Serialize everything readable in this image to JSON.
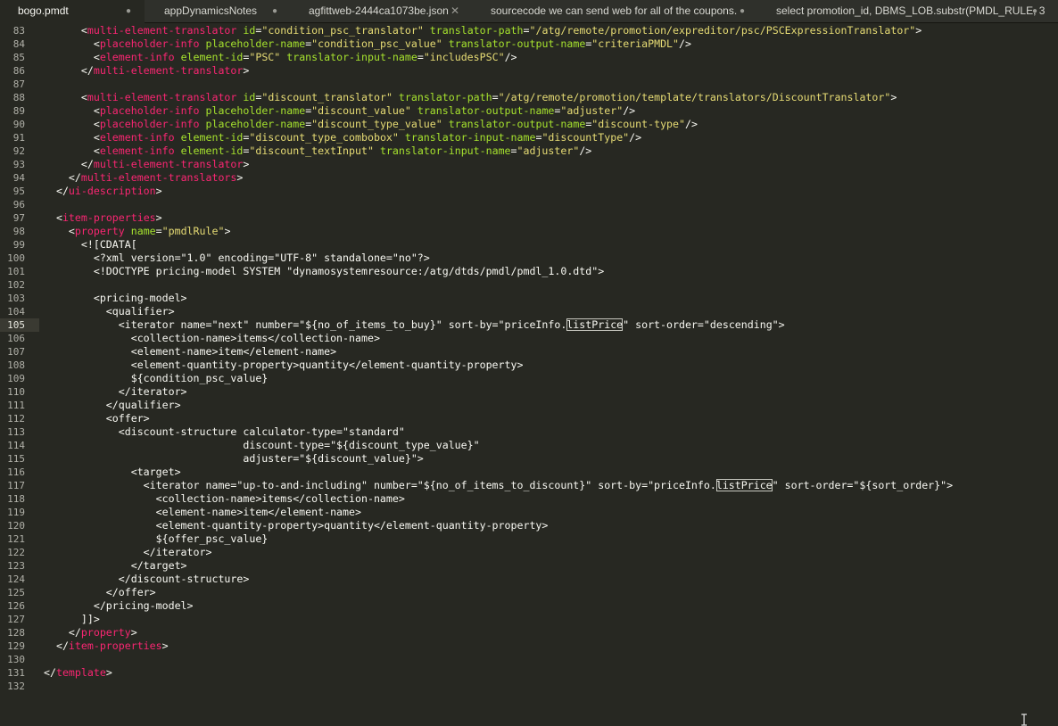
{
  "tabs": [
    {
      "label": "bogo.pmdt",
      "close": "●",
      "active": true
    },
    {
      "label": "appDynamicsNotes",
      "close": "●",
      "active": false
    },
    {
      "label": "agfittweb-2444ca1073be.json",
      "close": "✕",
      "active": false
    },
    {
      "label": "sourcecode we can send web for all of the coupons.",
      "close": "●",
      "active": false
    },
    {
      "label": "select promotion_id,  DBMS_LOB.substr(PMDL_RULE, 3",
      "close": "●",
      "active": false
    }
  ],
  "current_line": 105,
  "lines": [
    {
      "n": "83",
      "s": [
        [
          "pl",
          "      <"
        ],
        [
          "tg",
          "multi-element-translator"
        ],
        [
          "at",
          " id"
        ],
        [
          "pl",
          "="
        ],
        [
          "st",
          "\"condition_psc_translator\""
        ],
        [
          "at",
          " translator-path"
        ],
        [
          "pl",
          "="
        ],
        [
          "st",
          "\"/atg/remote/promotion/expreditor/psc/PSCExpressionTranslator\""
        ],
        [
          "pl",
          ">"
        ]
      ]
    },
    {
      "n": "84",
      "s": [
        [
          "pl",
          "        <"
        ],
        [
          "tg",
          "placeholder-info"
        ],
        [
          "at",
          " placeholder-name"
        ],
        [
          "pl",
          "="
        ],
        [
          "st",
          "\"condition_psc_value\""
        ],
        [
          "at",
          " translator-output-name"
        ],
        [
          "pl",
          "="
        ],
        [
          "st",
          "\"criteriaPMDL\""
        ],
        [
          "pl",
          "/>"
        ]
      ]
    },
    {
      "n": "85",
      "s": [
        [
          "pl",
          "        <"
        ],
        [
          "tg",
          "element-info"
        ],
        [
          "at",
          " element-id"
        ],
        [
          "pl",
          "="
        ],
        [
          "st",
          "\"PSC\""
        ],
        [
          "at",
          " translator-input-name"
        ],
        [
          "pl",
          "="
        ],
        [
          "st",
          "\"includesPSC\""
        ],
        [
          "pl",
          "/>"
        ]
      ]
    },
    {
      "n": "86",
      "s": [
        [
          "pl",
          "      </"
        ],
        [
          "tg",
          "multi-element-translator"
        ],
        [
          "pl",
          ">"
        ]
      ]
    },
    {
      "n": "87",
      "s": []
    },
    {
      "n": "88",
      "s": [
        [
          "pl",
          "      <"
        ],
        [
          "tg",
          "multi-element-translator"
        ],
        [
          "at",
          " id"
        ],
        [
          "pl",
          "="
        ],
        [
          "st",
          "\"discount_translator\""
        ],
        [
          "at",
          " translator-path"
        ],
        [
          "pl",
          "="
        ],
        [
          "st",
          "\"/atg/remote/promotion/template/translators/DiscountTranslator\""
        ],
        [
          "pl",
          ">"
        ]
      ]
    },
    {
      "n": "89",
      "s": [
        [
          "pl",
          "        <"
        ],
        [
          "tg",
          "placeholder-info"
        ],
        [
          "at",
          " placeholder-name"
        ],
        [
          "pl",
          "="
        ],
        [
          "st",
          "\"discount_value\""
        ],
        [
          "at",
          " translator-output-name"
        ],
        [
          "pl",
          "="
        ],
        [
          "st",
          "\"adjuster\""
        ],
        [
          "pl",
          "/>"
        ]
      ]
    },
    {
      "n": "90",
      "s": [
        [
          "pl",
          "        <"
        ],
        [
          "tg",
          "placeholder-info"
        ],
        [
          "at",
          " placeholder-name"
        ],
        [
          "pl",
          "="
        ],
        [
          "st",
          "\"discount_type_value\""
        ],
        [
          "at",
          " translator-output-name"
        ],
        [
          "pl",
          "="
        ],
        [
          "st",
          "\"discount-type\""
        ],
        [
          "pl",
          "/>"
        ]
      ]
    },
    {
      "n": "91",
      "s": [
        [
          "pl",
          "        <"
        ],
        [
          "tg",
          "element-info"
        ],
        [
          "at",
          " element-id"
        ],
        [
          "pl",
          "="
        ],
        [
          "st",
          "\"discount_type_combobox\""
        ],
        [
          "at",
          " translator-input-name"
        ],
        [
          "pl",
          "="
        ],
        [
          "st",
          "\"discountType\""
        ],
        [
          "pl",
          "/>"
        ]
      ]
    },
    {
      "n": "92",
      "s": [
        [
          "pl",
          "        <"
        ],
        [
          "tg",
          "element-info"
        ],
        [
          "at",
          " element-id"
        ],
        [
          "pl",
          "="
        ],
        [
          "st",
          "\"discount_textInput\""
        ],
        [
          "at",
          " translator-input-name"
        ],
        [
          "pl",
          "="
        ],
        [
          "st",
          "\"adjuster\""
        ],
        [
          "pl",
          "/>"
        ]
      ]
    },
    {
      "n": "93",
      "s": [
        [
          "pl",
          "      </"
        ],
        [
          "tg",
          "multi-element-translator"
        ],
        [
          "pl",
          ">"
        ]
      ]
    },
    {
      "n": "94",
      "s": [
        [
          "pl",
          "    </"
        ],
        [
          "tg",
          "multi-element-translators"
        ],
        [
          "pl",
          ">"
        ]
      ]
    },
    {
      "n": "95",
      "s": [
        [
          "pl",
          "  </"
        ],
        [
          "tg",
          "ui-description"
        ],
        [
          "pl",
          ">"
        ]
      ]
    },
    {
      "n": "96",
      "s": []
    },
    {
      "n": "97",
      "s": [
        [
          "pl",
          "  <"
        ],
        [
          "tg",
          "item-properties"
        ],
        [
          "pl",
          ">"
        ]
      ]
    },
    {
      "n": "98",
      "s": [
        [
          "pl",
          "    <"
        ],
        [
          "tg",
          "property"
        ],
        [
          "at",
          " name"
        ],
        [
          "pl",
          "="
        ],
        [
          "st",
          "\"pmdlRule\""
        ],
        [
          "pl",
          ">"
        ]
      ]
    },
    {
      "n": "99",
      "s": [
        [
          "pl",
          "      <![CDATA["
        ]
      ]
    },
    {
      "n": "100",
      "s": [
        [
          "pl",
          "        <?xml version=\"1.0\" encoding=\"UTF-8\" standalone=\"no\"?>"
        ]
      ]
    },
    {
      "n": "101",
      "s": [
        [
          "pl",
          "        <!DOCTYPE pricing-model SYSTEM \"dynamosystemresource:/atg/dtds/pmdl/pmdl_1.0.dtd\">"
        ]
      ]
    },
    {
      "n": "102",
      "s": []
    },
    {
      "n": "103",
      "s": [
        [
          "pl",
          "        <pricing-model>"
        ]
      ]
    },
    {
      "n": "104",
      "s": [
        [
          "pl",
          "          <qualifier>"
        ]
      ]
    },
    {
      "n": "105",
      "s": [
        [
          "pl",
          "            <iterator name=\"next\" number=\"${no_of_items_to_buy}\" sort-by=\"priceInfo."
        ],
        [
          "hl",
          "listPrice"
        ],
        [
          "pl",
          "\" sort-order=\"descending\">"
        ]
      ]
    },
    {
      "n": "106",
      "s": [
        [
          "pl",
          "              <collection-name>items</collection-name>"
        ]
      ]
    },
    {
      "n": "107",
      "s": [
        [
          "pl",
          "              <element-name>item</element-name>"
        ]
      ]
    },
    {
      "n": "108",
      "s": [
        [
          "pl",
          "              <element-quantity-property>quantity</element-quantity-property>"
        ]
      ]
    },
    {
      "n": "109",
      "s": [
        [
          "pl",
          "              ${condition_psc_value}"
        ]
      ]
    },
    {
      "n": "110",
      "s": [
        [
          "pl",
          "            </iterator>"
        ]
      ]
    },
    {
      "n": "111",
      "s": [
        [
          "pl",
          "          </qualifier>"
        ]
      ]
    },
    {
      "n": "112",
      "s": [
        [
          "pl",
          "          <offer>"
        ]
      ]
    },
    {
      "n": "113",
      "s": [
        [
          "pl",
          "            <discount-structure calculator-type=\"standard\""
        ]
      ]
    },
    {
      "n": "114",
      "s": [
        [
          "pl",
          "                                discount-type=\"${discount_type_value}\""
        ]
      ]
    },
    {
      "n": "115",
      "s": [
        [
          "pl",
          "                                adjuster=\"${discount_value}\">"
        ]
      ]
    },
    {
      "n": "116",
      "s": [
        [
          "pl",
          "              <target>"
        ]
      ]
    },
    {
      "n": "117",
      "s": [
        [
          "pl",
          "                <iterator name=\"up-to-and-including\" number=\"${no_of_items_to_discount}\" sort-by=\"priceInfo."
        ],
        [
          "hl",
          "listPrice"
        ],
        [
          "pl",
          "\" sort-order=\"${sort_order}\">"
        ]
      ]
    },
    {
      "n": "118",
      "s": [
        [
          "pl",
          "                  <collection-name>items</collection-name>"
        ]
      ]
    },
    {
      "n": "119",
      "s": [
        [
          "pl",
          "                  <element-name>item</element-name>"
        ]
      ]
    },
    {
      "n": "120",
      "s": [
        [
          "pl",
          "                  <element-quantity-property>quantity</element-quantity-property>"
        ]
      ]
    },
    {
      "n": "121",
      "s": [
        [
          "pl",
          "                  ${offer_psc_value}"
        ]
      ]
    },
    {
      "n": "122",
      "s": [
        [
          "pl",
          "                </iterator>"
        ]
      ]
    },
    {
      "n": "123",
      "s": [
        [
          "pl",
          "              </target>"
        ]
      ]
    },
    {
      "n": "124",
      "s": [
        [
          "pl",
          "            </discount-structure>"
        ]
      ]
    },
    {
      "n": "125",
      "s": [
        [
          "pl",
          "          </offer>"
        ]
      ]
    },
    {
      "n": "126",
      "s": [
        [
          "pl",
          "        </pricing-model>"
        ]
      ]
    },
    {
      "n": "127",
      "s": [
        [
          "pl",
          "      ]]>"
        ]
      ]
    },
    {
      "n": "128",
      "s": [
        [
          "pl",
          "    </"
        ],
        [
          "tg",
          "property"
        ],
        [
          "pl",
          ">"
        ]
      ]
    },
    {
      "n": "129",
      "s": [
        [
          "pl",
          "  </"
        ],
        [
          "tg",
          "item-properties"
        ],
        [
          "pl",
          ">"
        ]
      ]
    },
    {
      "n": "130",
      "s": []
    },
    {
      "n": "131",
      "s": [
        [
          "pl",
          "</"
        ],
        [
          "tg",
          "template"
        ],
        [
          "pl",
          ">"
        ]
      ]
    },
    {
      "n": "132",
      "s": []
    }
  ]
}
